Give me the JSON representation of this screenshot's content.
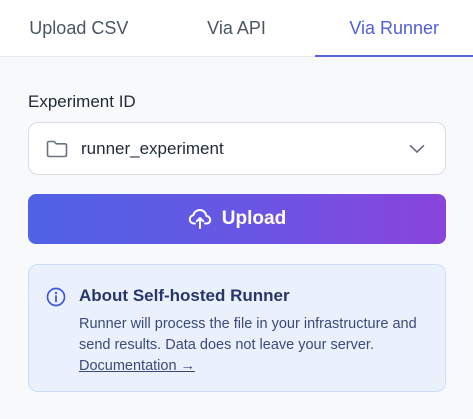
{
  "tabs": [
    {
      "label": "Upload CSV",
      "active": false
    },
    {
      "label": "Via API",
      "active": false
    },
    {
      "label": "Via Runner",
      "active": true
    }
  ],
  "experiment": {
    "label": "Experiment ID",
    "selected_value": "runner_experiment",
    "icon": "folder-icon",
    "dropdown_icon": "chevron-down-icon"
  },
  "upload": {
    "label": "Upload",
    "icon": "cloud-upload-icon"
  },
  "info": {
    "icon": "info-icon",
    "title": "About Self-hosted Runner",
    "description": "Runner will process the file in your infrastructure and send results. Data does not leave your server.",
    "link_label": "Documentation →"
  },
  "colors": {
    "accent": "#5a63e0",
    "button_gradient_start": "#4f63e6",
    "button_gradient_end": "#8a44dc",
    "info_background": "#eaf1fd",
    "info_title": "#26366b"
  }
}
